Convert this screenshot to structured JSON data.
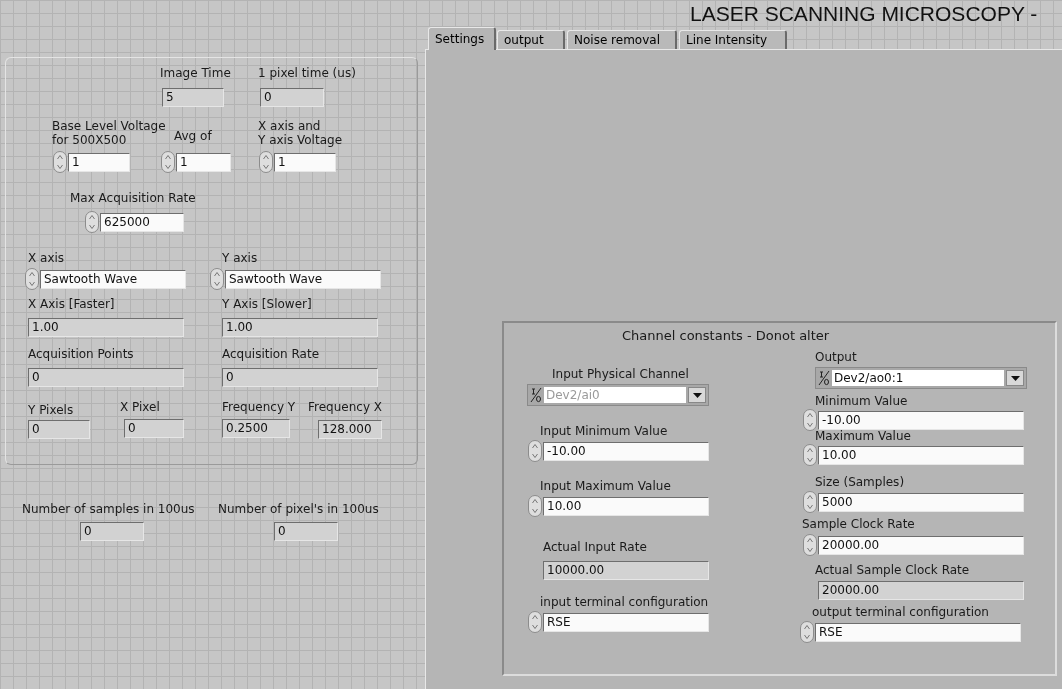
{
  "title": "LASER SCANNING MICROSCOPY -",
  "tabs": [
    {
      "label": "Settings",
      "selected": true
    },
    {
      "label": "output",
      "selected": false
    },
    {
      "label": "Noise removal",
      "selected": false
    },
    {
      "label": "Line Intensity",
      "selected": false
    }
  ],
  "left_panel": {
    "controls": [
      {
        "kind": "indicator",
        "label": "Image Time",
        "value": "5",
        "disabled": false
      },
      {
        "kind": "indicator",
        "label": "1 pixel time (us)",
        "value": "0",
        "disabled": false
      },
      {
        "kind": "numeric",
        "label": "Base Level Voltage\nfor 500X500",
        "value": "1",
        "disabled": false
      },
      {
        "kind": "numeric",
        "label": "Avg of",
        "value": "1",
        "disabled": false
      },
      {
        "kind": "numeric",
        "label": "X axis and\nY axis Voltage",
        "value": "1",
        "disabled": false
      },
      {
        "kind": "numeric",
        "label": "Max Acquisition Rate",
        "value": "625000",
        "disabled": false
      },
      {
        "kind": "ring",
        "label": "X axis",
        "value": "Sawtooth Wave",
        "disabled": false
      },
      {
        "kind": "ring",
        "label": "Y axis",
        "value": "Sawtooth Wave",
        "disabled": false
      },
      {
        "kind": "indicator",
        "label": "X Axis [Faster]",
        "value": "1.00",
        "disabled": false
      },
      {
        "kind": "indicator",
        "label": "Y Axis [Slower]",
        "value": "1.00",
        "disabled": false
      },
      {
        "kind": "indicator",
        "label": "Acquisition Points",
        "value": "0",
        "disabled": false
      },
      {
        "kind": "indicator",
        "label": "Acquisition Rate",
        "value": "0",
        "disabled": false
      },
      {
        "kind": "indicator",
        "label": "Y Pixels",
        "value": "0",
        "disabled": false
      },
      {
        "kind": "indicator",
        "label": "X Pixel",
        "value": "0",
        "disabled": false
      },
      {
        "kind": "indicator",
        "label": "Frequency Y",
        "value": "0.2500",
        "disabled": false
      },
      {
        "kind": "indicator",
        "label": "Frequency X",
        "value": "128.000",
        "disabled": false
      }
    ]
  },
  "outside_controls": [
    {
      "kind": "indicator",
      "label": "Number of samples in 100us",
      "value": "0",
      "disabled": false
    },
    {
      "kind": "indicator",
      "label": "Number of pixel's in 100us",
      "value": "0",
      "disabled": false
    }
  ],
  "channel_constants": {
    "title": "Channel constants - Donot alter",
    "controls": [
      {
        "kind": "io",
        "label": "Input Physical Channel",
        "value": "Dev2/ai0",
        "disabled": true
      },
      {
        "kind": "numeric",
        "label": "Input Minimum Value",
        "value": "-10.00",
        "disabled": false
      },
      {
        "kind": "numeric",
        "label": "Input Maximum Value",
        "value": "10.00",
        "disabled": false
      },
      {
        "kind": "indicator",
        "label": "Actual Input Rate",
        "value": "10000.00",
        "disabled": false
      },
      {
        "kind": "ring",
        "label": "input terminal configuration",
        "value": "RSE",
        "disabled": false
      },
      {
        "kind": "io",
        "label": "Output",
        "value": "Dev2/ao0:1",
        "disabled": false
      },
      {
        "kind": "numeric",
        "label": "Minimum Value",
        "value": "-10.00",
        "disabled": false
      },
      {
        "kind": "numeric",
        "label": "Maximum Value",
        "value": "10.00",
        "disabled": false
      },
      {
        "kind": "numeric",
        "label": "Size (Samples)",
        "value": "5000",
        "disabled": false
      },
      {
        "kind": "numeric",
        "label": "Sample Clock Rate",
        "value": "20000.00",
        "disabled": false
      },
      {
        "kind": "indicator",
        "label": "Actual Sample Clock Rate",
        "value": "20000.00",
        "disabled": false
      },
      {
        "kind": "ring",
        "label": "output terminal configuration",
        "value": "RSE",
        "disabled": false
      }
    ]
  }
}
